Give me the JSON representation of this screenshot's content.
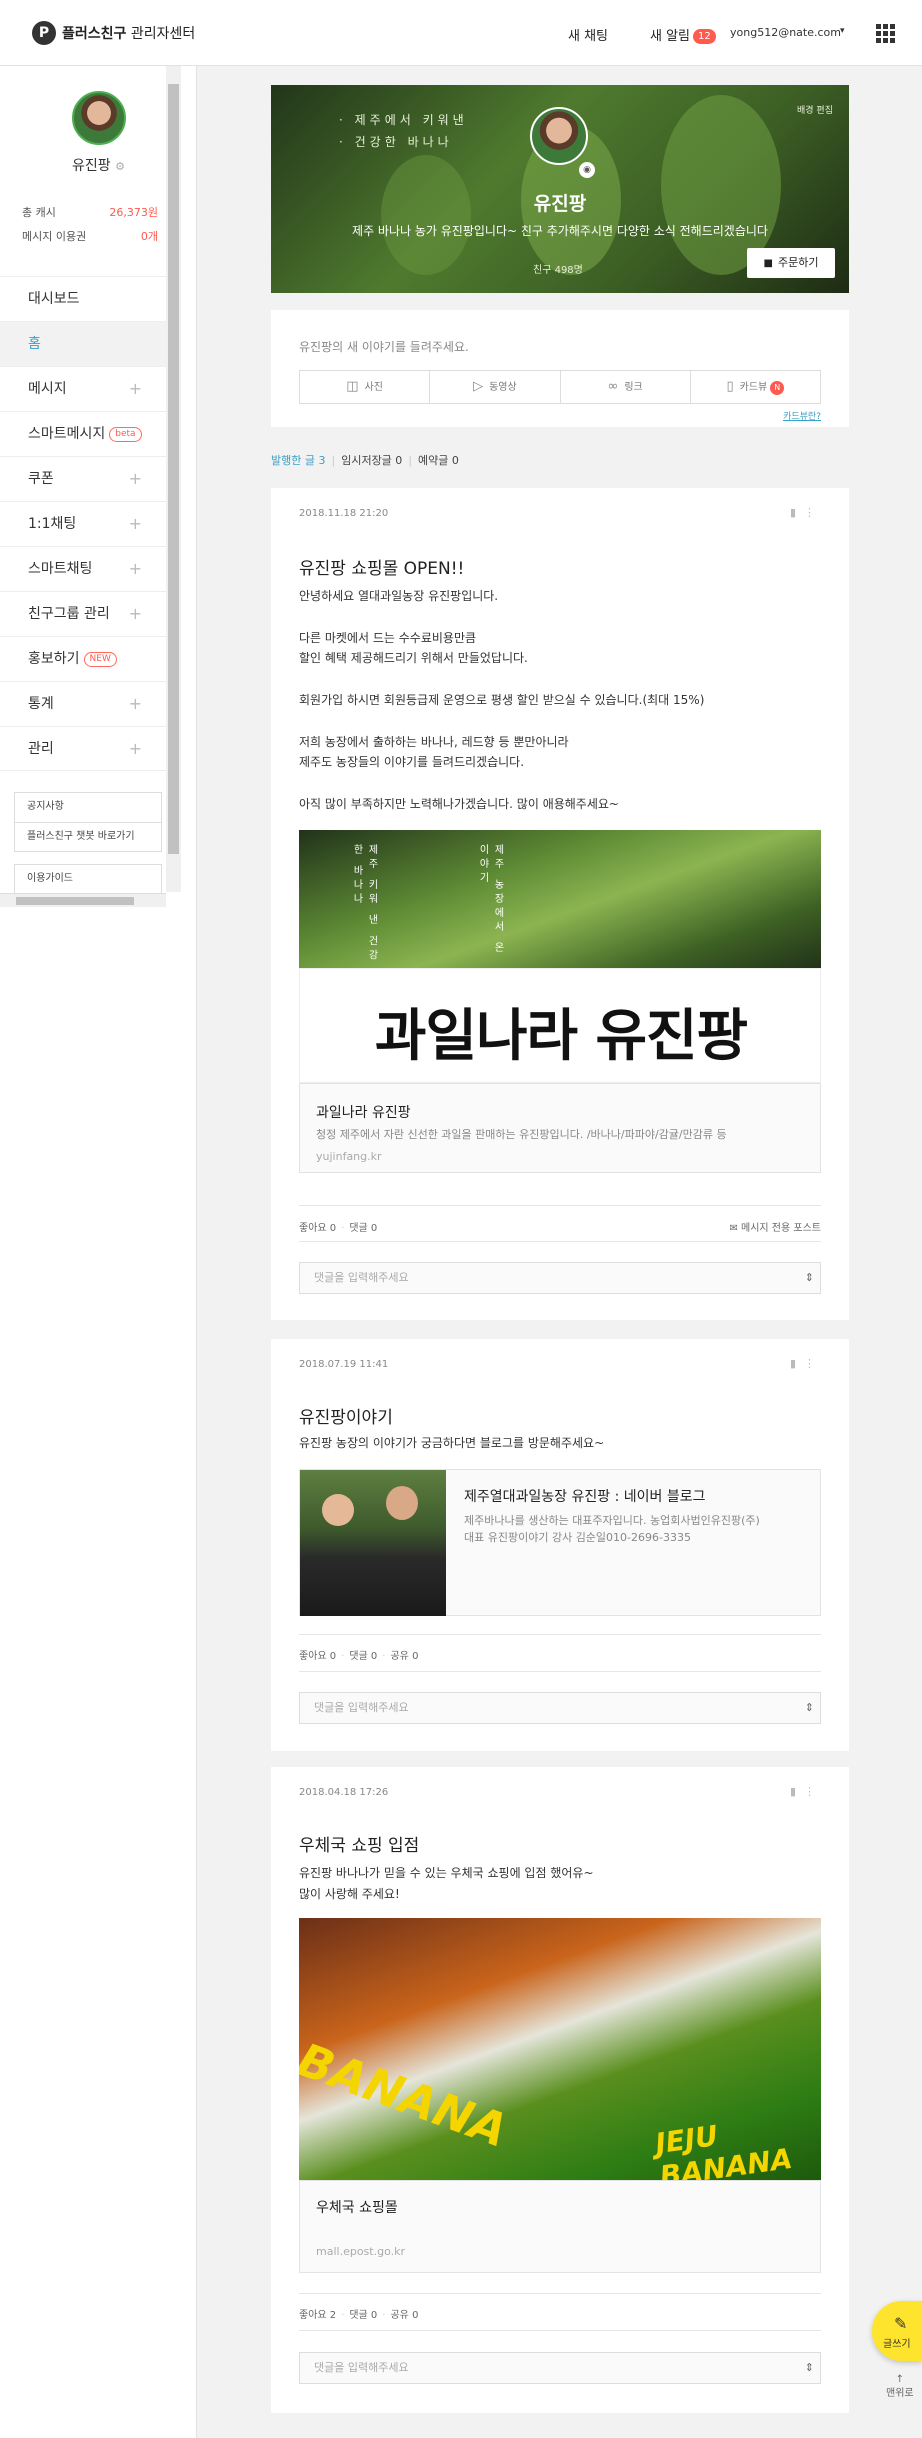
{
  "header": {
    "logo_mark": "P",
    "logo_brand": "플러스친구",
    "logo_suffix": " 관리자센터",
    "chat_label": "새 채팅",
    "alert_label": "새 알림",
    "alert_count": "12",
    "user_email": "yong512@nate.com",
    "caret": "▾"
  },
  "sidebar": {
    "profile_name": "유진팡",
    "stats": [
      {
        "label": "총 캐시",
        "value": "26,373원"
      },
      {
        "label": "메시지 이용권",
        "value": "0개"
      }
    ],
    "menu": [
      {
        "label": "대시보드",
        "plus": ""
      },
      {
        "label": "홈",
        "plus": ""
      },
      {
        "label": "메시지",
        "plus": "+"
      },
      {
        "label": "스마트메시지",
        "plus": "",
        "tag": "beta"
      },
      {
        "label": "쿠폰",
        "plus": "+"
      },
      {
        "label": "1:1채팅",
        "plus": "+"
      },
      {
        "label": "스마트채팅",
        "plus": "+"
      },
      {
        "label": "친구그룹 관리",
        "plus": "+"
      },
      {
        "label": "홍보하기",
        "plus": "",
        "tag": "NEW"
      },
      {
        "label": "통계",
        "plus": "+"
      },
      {
        "label": "관리",
        "plus": "+"
      }
    ],
    "links": [
      "공지사항",
      "플러스친구 챗봇 바로가기",
      "이용가이드"
    ]
  },
  "cover": {
    "poem_line1": "· 제주에서 키워낸",
    "poem_line2": "· 건강한 바나나",
    "edit_label": "배경 편집",
    "name": "유진팡",
    "description": "제주 바나나 농가 유진팡입니다~ 친구 추가해주시면 다양한 소식 전해드리겠습니다",
    "friends": "친구 498명",
    "order_button": "주문하기"
  },
  "compose": {
    "placeholder": "유진팡의 새 이야기를 들려주세요.",
    "buttons": [
      "사진",
      "동영상",
      "링크",
      "카드뷰"
    ],
    "cardview_badge": "N",
    "link": "카드뷰란?"
  },
  "filter": {
    "published": "발행한 글 3",
    "temp": "임시저장글 0",
    "scheduled": "예약글 0"
  },
  "posts": [
    {
      "date": "2018.11.18 21:20",
      "title": "유진팡 쇼핑몰 OPEN!!",
      "body": "안녕하세요 열대과일농장 유진팡입니다.\n\n다른 마켓에서 드는 수수료비용만큼\n할인 혜택 제공해드리기 위해서 만들었답니다.\n\n회원가입 하시면 회원등급제 운영으로 평생 할인 받으실 수 있습니다.(최대 15%)\n\n저희 농장에서 출하하는 바나나, 레드향 등 뿐만아니라\n제주도 농장들의 이야기를 들려드리겠습니다.\n\n아직 많이 부족하지만 노력해나가겠습니다. 많이 애용해주세요~",
      "image_text_left": "제주 키워 낸 건강한 바나나",
      "image_text_right": "제주 농장에서 온 이야기",
      "logo_text": "과일나라 유진팡",
      "link_title": "과일나라 유진팡",
      "link_desc": "청정 제주에서 자란 신선한 과일을 판매하는 유진팡입니다. /바나나/파파야/감귤/만감류 등",
      "link_url": "yujinfang.kr",
      "likes": "좋아요 0",
      "comments": "댓글 0",
      "shares": "",
      "message_only": "메시지 전용 포스트",
      "comment_placeholder": "댓글을 입력해주세요"
    },
    {
      "date": "2018.07.19 11:41",
      "title": "유진팡이야기",
      "body": "유진팡 농장의 이야기가 궁금하다면 블로그를 방문해주세요~",
      "link_title": "제주열대과일농장 유진팡 : 네이버 블로그",
      "link_desc": "제주바나나를 생산하는 대표주자입니다. 농업회사법인유진팡(주)\n대표 유진팡이야기 강사 김순일010-2696-3335",
      "likes": "좋아요 0",
      "comments": "댓글 0",
      "shares": "공유 0",
      "comment_placeholder": "댓글을 입력해주세요"
    },
    {
      "date": "2018.04.18 17:26",
      "title": "우체국 쇼핑 입점",
      "body": "유진팡 바나나가 믿을 수 있는 우체국 쇼핑에 입점 했어유~\n많이 사랑해 주세요!",
      "box_text": "BANANA",
      "box_text2": "JEJU BANANA",
      "link_title": "우체국 쇼핑몰",
      "link_url": "mall.epost.go.kr",
      "likes": "좋아요 2",
      "comments": "댓글 0",
      "shares": "공유 0",
      "comment_placeholder": "댓글을 입력해주세요"
    }
  ],
  "fab": {
    "label": "글쓰기",
    "icon": "pencil-icon"
  },
  "to_top": {
    "label": "맨위로"
  }
}
